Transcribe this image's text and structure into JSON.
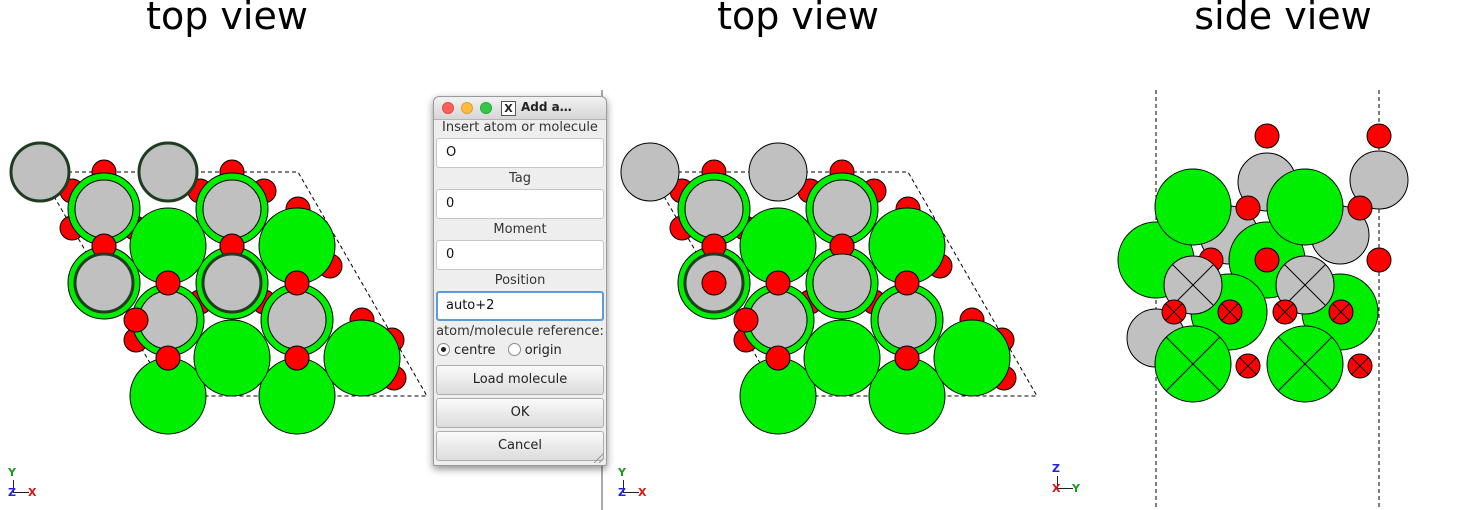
{
  "views": {
    "left_title": "top view",
    "middle_title": "top view",
    "right_title": "side view"
  },
  "colors": {
    "oxygen": "#ff0000",
    "metal_grey": "#c0c0c0",
    "metal_green": "#00ee00",
    "outline": "#000000",
    "selection_ring": "#1e3d1e"
  },
  "axes": {
    "top_left": {
      "vertical": "Y",
      "horizontal": "X",
      "out_of_plane": "Z"
    },
    "top_middle": {
      "vertical": "Y",
      "horizontal": "X",
      "out_of_plane": "Z"
    },
    "side": {
      "vertical": "Z",
      "horizontal": "Y",
      "out_of_plane": "X"
    }
  },
  "dialog": {
    "title": "Add a…",
    "x_logo": "X",
    "insert_label": "Insert atom or molecule",
    "insert_value": "O",
    "tag_label": "Tag",
    "tag_value": "0",
    "moment_label": "Moment",
    "moment_value": "0",
    "position_label": "Position",
    "position_value": "auto+2",
    "reference_label": "atom/molecule reference:",
    "reference_options": [
      "centre",
      "origin"
    ],
    "reference_selected": "centre",
    "load_button": "Load molecule",
    "ok_button": "OK",
    "cancel_button": "Cancel"
  }
}
